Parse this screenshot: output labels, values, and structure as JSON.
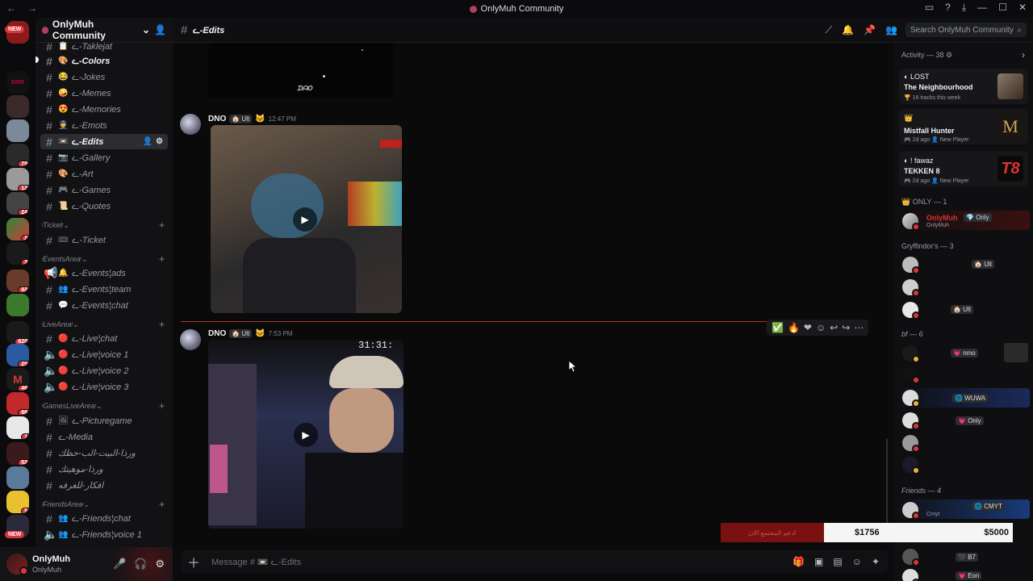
{
  "window": {
    "title": "OnlyMuh Community"
  },
  "guild": {
    "name": "OnlyMuh Community"
  },
  "channels": {
    "items": [
      {
        "label": "ᓚ-Taklejat",
        "emoji": "📋"
      },
      {
        "label": "ᓚ-Colors",
        "emoji": "🎨"
      },
      {
        "label": "ᓚ-Jokes",
        "emoji": "😂"
      },
      {
        "label": "ᓚ-Memes",
        "emoji": "🤪"
      },
      {
        "label": "ᓚ-Memories",
        "emoji": "😍"
      },
      {
        "label": "ᓚ-Emots",
        "emoji": "👮"
      },
      {
        "label": "ᓚ-Edits",
        "emoji": "📼"
      },
      {
        "label": "ᓚ-Gallery",
        "emoji": "📷"
      },
      {
        "label": "ᓚ-Art",
        "emoji": "🎨"
      },
      {
        "label": "ᓚ-Games",
        "emoji": "🎮"
      },
      {
        "label": "ᓚ-Quotes",
        "emoji": "📜"
      }
    ],
    "cat_ticket": "ᵎTicketᵎ ",
    "ticket": {
      "label": "ᓚ-Ticket",
      "emoji": "🎟"
    },
    "cat_events": "ᵎEventsAreaᵎ ",
    "events": [
      {
        "label": "ᓚ-Events¦ads",
        "emoji": "🔔"
      },
      {
        "label": "ᓚ-Events¦team",
        "emoji": "👥"
      },
      {
        "label": "ᓚ-Events¦chat",
        "emoji": "💬"
      }
    ],
    "cat_live": "ᵎLiveAreaᵎ ",
    "live": [
      {
        "label": "ᓚ-Live¦chat",
        "emoji": "🔴"
      },
      {
        "label": "ᓚ-Live¦voice 1",
        "emoji": "🔴"
      },
      {
        "label": "ᓚ-Live¦voice 2",
        "emoji": "🔴"
      },
      {
        "label": "ᓚ-Live¦voice 3",
        "emoji": "🔴"
      }
    ],
    "cat_games": "ᵎGamesLiveAreaᵎ ",
    "games": [
      {
        "label": "ᓚ-Picturegame",
        "emoji": "🖼"
      },
      {
        "label": "ᓚ-Media",
        "emoji": ""
      },
      {
        "label": "ورذا-البيت-الب-حظك",
        "emoji": ""
      },
      {
        "label": "ورذا-موهيتك",
        "emoji": ""
      },
      {
        "label": "افكار-للغرفه",
        "emoji": ""
      }
    ],
    "cat_friends": "ᵎFriendsAreaᵎ ",
    "friends": [
      {
        "label": "ᓚ-Friends¦chat",
        "emoji": "👥"
      },
      {
        "label": "ᓚ-Friends¦voice 1",
        "emoji": "👥"
      }
    ]
  },
  "user": {
    "name": "OnlyMuh",
    "status": "OnlyMuh"
  },
  "header": {
    "channel": "ᓚ-Edits",
    "search_placeholder": "Search OnlyMuh Community"
  },
  "messages": [
    {
      "author": "DNO",
      "tag": "Ult",
      "time": "12:47 PM"
    },
    {
      "author": "DNO",
      "tag": "Ult",
      "time": "7:53 PM"
    }
  ],
  "video1_caption": "ᗪᗩO",
  "video2_overlay": "31:31:",
  "composer": {
    "placeholder": "Message # 📼 ᓚ-Edits"
  },
  "activity": {
    "title": "Activity — 38",
    "cards": [
      {
        "l1": "LOST",
        "l2": "The Neighbourhood",
        "l3": "16 tracks this week"
      },
      {
        "l1": "",
        "l2": "Mistfall Hunter",
        "l3a": "2d ago",
        "l3b": "New Player"
      },
      {
        "l1": "! fawaz",
        "l2": "TEKKEN 8",
        "l3a": "2d ago",
        "l3b": "New Player"
      }
    ]
  },
  "member_groups": {
    "only": "ONLY — 1",
    "gryffindor": "Gryffindor's — 3",
    "bf": "bf — 6",
    "friends": "Friends — 4"
  },
  "members": {
    "onlymuh_name": "OnlyMuh",
    "onlymuh_tag": "Only",
    "onlymuh_sub": "OnlyMuh",
    "ult_tag": "Ult",
    "nmo_tag": "nmo",
    "wuwa_tag": "WUWA",
    "only_tag": "Only",
    "cmyt_tag": "CMYT",
    "cmyt_sub": "Cmyt",
    "b7_tag": "B7",
    "eon_tag": "Eon"
  },
  "goal": {
    "current": "$1756",
    "target": "$5000",
    "label": "ادعم المجتمع الان"
  },
  "rail": {
    "new_top": "NEW",
    "new_bottom": "NEW",
    "badges": [
      "79",
      "12",
      "24",
      "2",
      "3",
      "92",
      "620",
      "20",
      "46",
      "88",
      "1",
      "52",
      "5"
    ]
  },
  "colors": {
    "accent_red": "#da373c",
    "goal_red": "#7a1111",
    "online_green": "#23a55a"
  }
}
